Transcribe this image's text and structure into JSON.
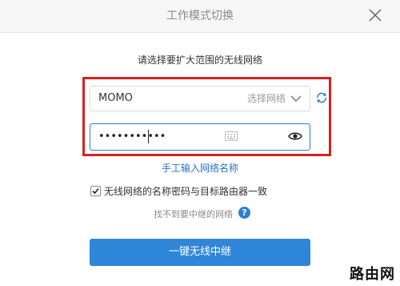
{
  "dialog": {
    "title": "工作模式切换",
    "subtitle": "请选择要扩大范围的无线网络"
  },
  "network": {
    "ssid": "MOMO",
    "select_label": "选择网络",
    "password_masked": "•••••••••••",
    "password_visible": false
  },
  "links": {
    "manual_input": "手工输入网络名称",
    "cannot_find": "找不到要中继的网络"
  },
  "checkbox": {
    "label": "无线网络的名称密码与目标路由器一致",
    "checked": true
  },
  "help_icon_text": "?",
  "primary_button": "一键无线中继",
  "watermark": "路由网",
  "colors": {
    "accent": "#2f86d9",
    "highlight_frame": "#d8201e",
    "link": "#2a6fc1",
    "header_bg": "#f6f6f6"
  },
  "icons": [
    "close-icon",
    "chevron-down-icon",
    "refresh-icon",
    "keyboard-icon",
    "eye-icon",
    "checkmark-icon",
    "help-icon"
  ]
}
